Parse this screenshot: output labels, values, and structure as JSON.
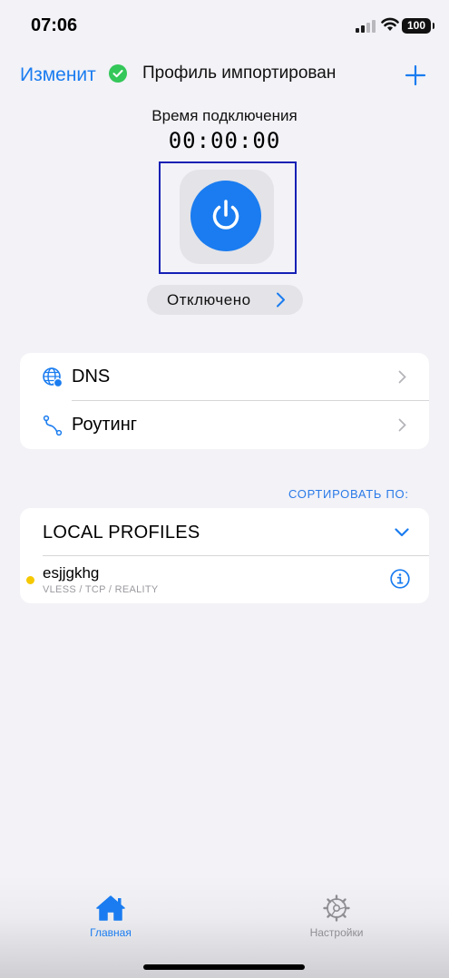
{
  "status_bar": {
    "time": "07:06",
    "battery": "100",
    "signal_icon": "cellular-signal-icon",
    "wifi_icon": "wifi-icon"
  },
  "nav": {
    "edit_label": "Изменит",
    "profile_status": "Профиль импортирован",
    "status_icon": "check-circle-icon",
    "add_icon": "plus-icon"
  },
  "connection": {
    "time_label": "Время подключения",
    "elapsed": "00:00:00",
    "power_icon": "power-icon",
    "state_label": "Отключено"
  },
  "menu": {
    "items": [
      {
        "label": "DNS",
        "icon": "globe-icon"
      },
      {
        "label": "Роутинг",
        "icon": "route-icon"
      }
    ]
  },
  "profiles": {
    "sort_label": "СОРТИРОВАТЬ ПО:",
    "group_title": "LOCAL PROFILES",
    "items": [
      {
        "name": "esjjgkhg",
        "meta": "VLESS / TCP / REALITY",
        "status_color": "#f5c800"
      }
    ]
  },
  "tab_bar": {
    "tabs": [
      {
        "label": "Главная",
        "icon": "home-icon",
        "active": true
      },
      {
        "label": "Настройки",
        "icon": "settings-gear-icon",
        "active": false
      }
    ]
  },
  "colors": {
    "accent": "#1a7cf0",
    "success": "#34c759",
    "background": "#f2f2f7"
  }
}
